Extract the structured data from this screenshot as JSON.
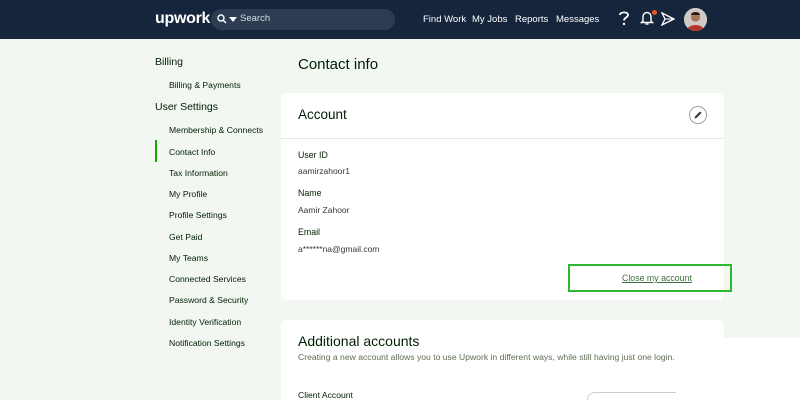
{
  "topnav": {
    "logo": "upwork",
    "search_placeholder": "Search",
    "links": [
      "Find Work",
      "My Jobs",
      "Reports",
      "Messages"
    ],
    "icons": [
      "help-icon",
      "bell-icon",
      "send-icon",
      "avatar"
    ],
    "colors": {
      "bg": "#14253c",
      "notification_dot": "#e8562a"
    }
  },
  "sidebar": {
    "billing_heading": "Billing",
    "billing_items": [
      "Billing & Payments"
    ],
    "settings_heading": "User Settings",
    "settings_items": [
      "Membership & Connects",
      "Contact Info",
      "Tax Information",
      "My Profile",
      "Profile Settings",
      "Get Paid",
      "My Teams",
      "Connected Services",
      "Password & Security",
      "Identity Verification",
      "Notification Settings"
    ],
    "active_item": "Contact Info",
    "accent_color": "#14a800"
  },
  "main": {
    "page_title": "Contact info",
    "account": {
      "title": "Account",
      "user_id_label": "User ID",
      "user_id": "aamirzahoor1",
      "name_label": "Name",
      "name": "Aamir Zahoor",
      "email_label": "Email",
      "email": "a******na@gmail.com",
      "close_link": "Close my account",
      "highlight_color": "#2fb82f"
    },
    "additional": {
      "title": "Additional accounts",
      "description": "Creating a new account allows you to use Upwork in different ways, while still having just one login.",
      "client_account_label": "Client Account"
    }
  }
}
